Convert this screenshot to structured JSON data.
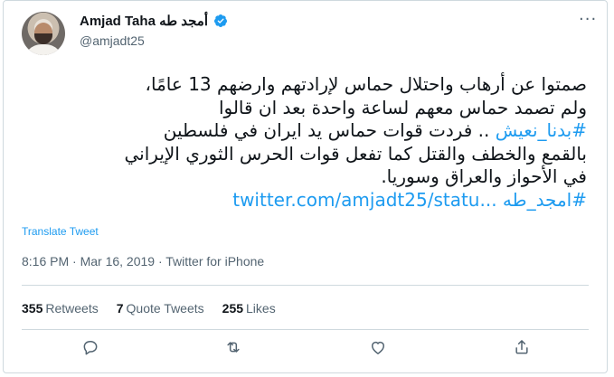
{
  "author": {
    "name": "Amjad Taha أمجد طه",
    "handle": "@amjadt25",
    "verified": true
  },
  "more_menu": "···",
  "tweet": {
    "lines": [
      "صمتوا عن أرهاب واحتلال حماس لإرادتهم وارضهم 13 عامًا،",
      "ولم تصمد حماس معهم لساعة  واحدة بعد ان قالوا",
      "فردت قوات حماس يد ايران في فلسطين",
      "بالقمع والخطف والقتل كما تفعل قوات الحرس الثوري الإيراني",
      "في الأحواز والعراق وسوريا."
    ],
    "hashtag_1": "#بدنا_نعيش",
    "line3_sep": " .. ",
    "hashtag_2": "#امجد_طه",
    "url": "twitter.com/amjadt25/statu..."
  },
  "translate_label": "Translate Tweet",
  "meta": "8:16 PM · Mar 16, 2019 · Twitter for iPhone",
  "stats": {
    "retweets_count": "355",
    "retweets_label": "Retweets",
    "quotes_count": "7",
    "quotes_label": "Quote Tweets",
    "likes_count": "255",
    "likes_label": "Likes"
  },
  "actions": [
    "reply-icon",
    "retweet-icon",
    "like-icon",
    "share-icon"
  ],
  "colors": {
    "link": "#1d9bf0",
    "muted": "#536471",
    "border": "#cfd9de",
    "text": "#0f1419"
  }
}
